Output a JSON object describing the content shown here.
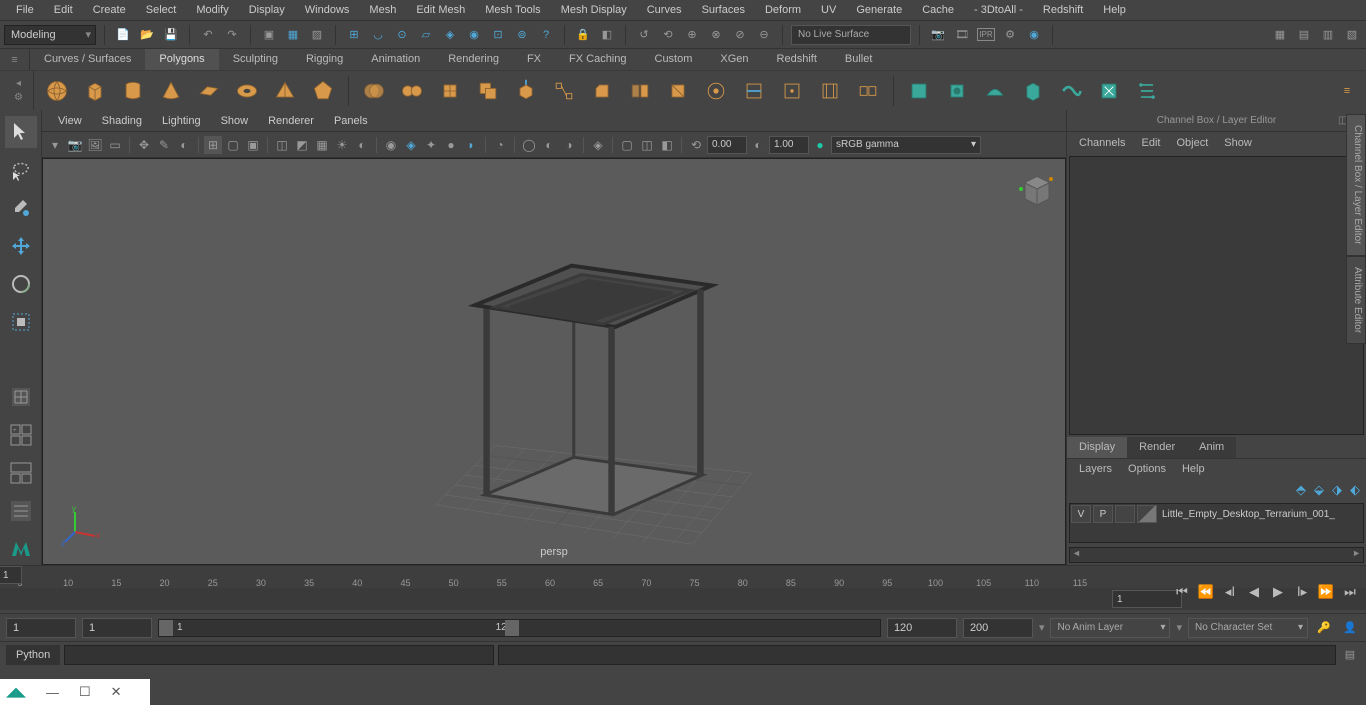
{
  "menubar": [
    "File",
    "Edit",
    "Create",
    "Select",
    "Modify",
    "Display",
    "Windows",
    "Mesh",
    "Edit Mesh",
    "Mesh Tools",
    "Mesh Display",
    "Curves",
    "Surfaces",
    "Deform",
    "UV",
    "Generate",
    "Cache",
    "- 3DtoAll -",
    "Redshift",
    "Help"
  ],
  "workspace": "Modeling",
  "live_surface": "No Live Surface",
  "shelf_tabs": [
    "Curves / Surfaces",
    "Polygons",
    "Sculpting",
    "Rigging",
    "Animation",
    "Rendering",
    "FX",
    "FX Caching",
    "Custom",
    "XGen",
    "Redshift",
    "Bullet"
  ],
  "active_shelf_tab": 1,
  "panel_menus": [
    "View",
    "Shading",
    "Lighting",
    "Show",
    "Renderer",
    "Panels"
  ],
  "panel_num1": "0.00",
  "panel_num2": "1.00",
  "panel_colorspace": "sRGB gamma",
  "viewport_label": "persp",
  "channelbox_title": "Channel Box / Layer Editor",
  "cb_menus": [
    "Channels",
    "Edit",
    "Object",
    "Show"
  ],
  "layer_tabs": [
    "Display",
    "Render",
    "Anim"
  ],
  "active_layer_tab": 0,
  "layer_menus": [
    "Layers",
    "Options",
    "Help"
  ],
  "layer_row": {
    "vis": "V",
    "play": "P",
    "name": "Little_Empty_Desktop_Terrarium_001_"
  },
  "side_tabs": [
    "Channel Box / Layer Editor",
    "Attribute Editor"
  ],
  "timeline": {
    "start_tick": 5,
    "end_tick": 115,
    "step": 5,
    "current": 1,
    "current_right": 1
  },
  "range": {
    "min": "1",
    "start": "1",
    "slider_start": "1",
    "slider_end": "120",
    "end": "120",
    "max": "200"
  },
  "anim_layer": "No Anim Layer",
  "char_set": "No Character Set",
  "cmd_label": "Python"
}
